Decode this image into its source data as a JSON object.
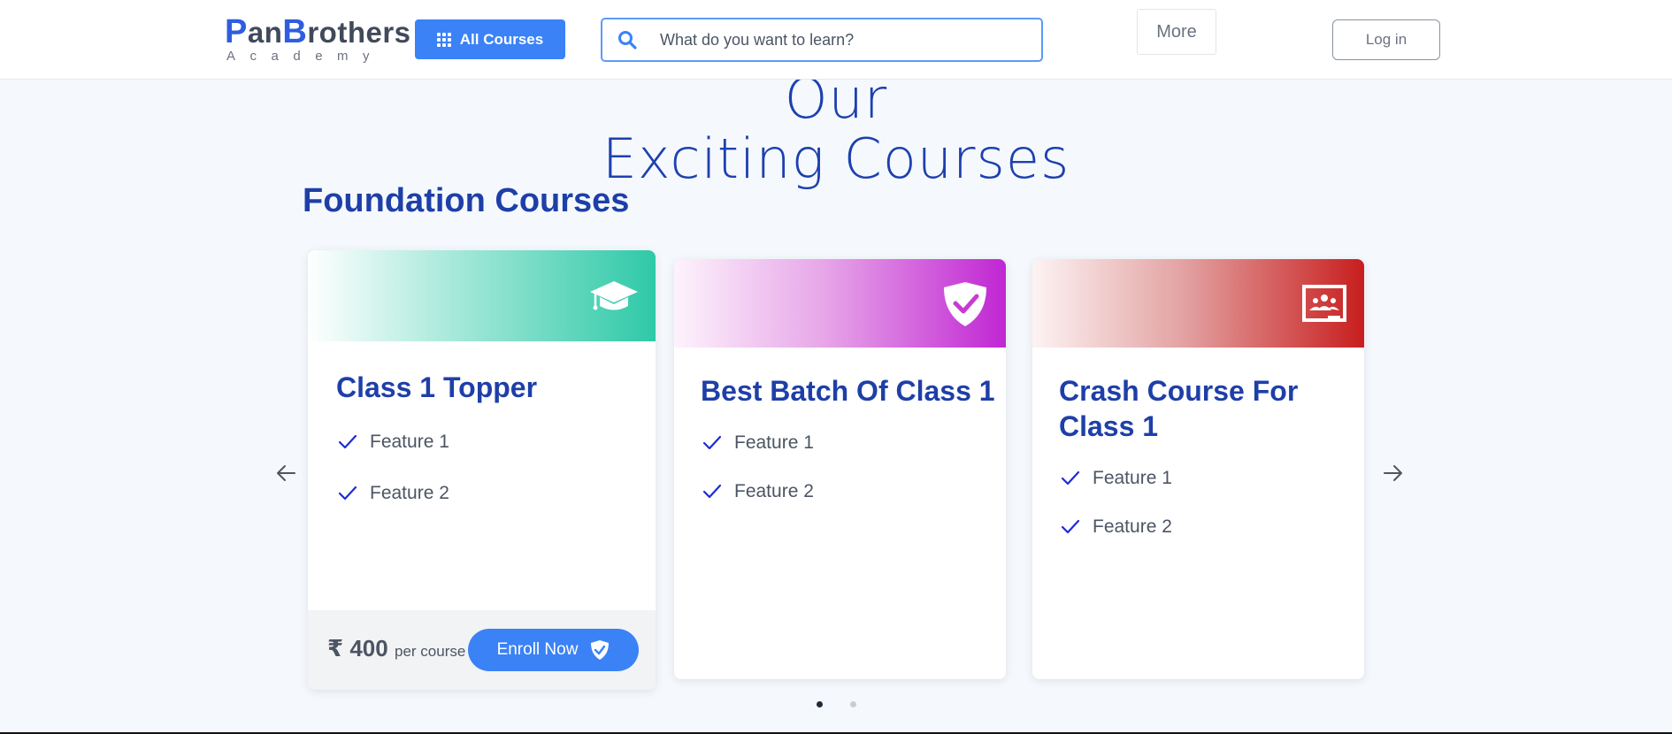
{
  "header": {
    "logo_part1": "P",
    "logo_part2": "an",
    "logo_part3": "B",
    "logo_part4": "rothers",
    "logo_sub": "Academy",
    "all_courses_label": "All Courses",
    "search_placeholder": "What do you want to learn?",
    "more_label": "More",
    "login_label": "Log in"
  },
  "hero": {
    "line1": "Embark on Your Learning Journey with Our",
    "line2": "Exciting Courses"
  },
  "section_title": "Foundation Courses",
  "colors": {
    "primary": "#3b82f6",
    "heading": "#1e3fa8",
    "teal": "#2ec9a7",
    "magenta": "#c026d3",
    "red": "#c81e1e"
  },
  "cards": [
    {
      "title": "Class 1 Topper",
      "icon": "graduation-cap-icon",
      "features": [
        "Feature 1",
        "Feature 2"
      ],
      "price": "₹ 400",
      "per": "per course",
      "enroll_label": "Enroll Now"
    },
    {
      "title": "Best Batch Of Class 1",
      "icon": "shield-check-icon",
      "features": [
        "Feature 1",
        "Feature 2"
      ]
    },
    {
      "title_line1": "Crash Course For",
      "title_line2": "Class 1",
      "icon": "classroom-icon",
      "features": [
        "Feature 1",
        "Feature 2"
      ]
    }
  ],
  "carousel": {
    "prev_icon": "arrow-left-icon",
    "next_icon": "arrow-right-icon",
    "pages": 2,
    "active_page": 1
  }
}
